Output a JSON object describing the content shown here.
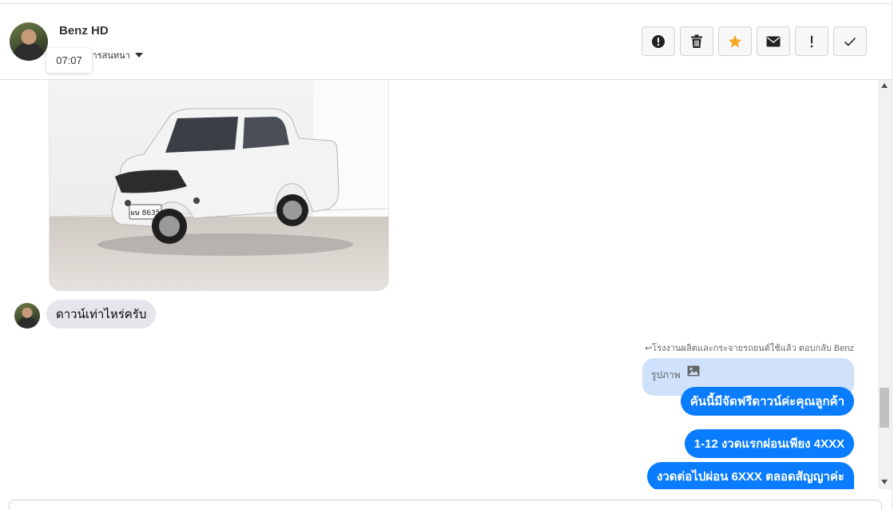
{
  "header": {
    "contact_name": "Benz HD",
    "sub_label": "ติดตามการสนทนา",
    "tooltip_time": "07:07",
    "toolbar": [
      {
        "name": "alert-circle-icon"
      },
      {
        "name": "trash-icon"
      },
      {
        "name": "star-icon",
        "color": "#f5a623"
      },
      {
        "name": "envelope-icon"
      },
      {
        "name": "exclamation-icon"
      },
      {
        "name": "check-icon"
      }
    ]
  },
  "messages": {
    "incoming_image_alt": "photo of white pickup truck, plate ผษ 8635",
    "plate_text": "ผษ 8635",
    "incoming_text": "ดาวน์เท่าไหร่ครับ",
    "reply_meta": "โรงงานผลิตและกระจายรถยนต์ใช้แล้ว ตอบกลับ Benz",
    "quoted_label": "รูปภาพ",
    "outgoing": [
      "คันนี้มีจัดฟรีดาวน์ค่ะคุณลูกค้า",
      "1-12 งวดแรกผ่อนเพียง 4XXX",
      "งวดต่อไปผ่อน 6XXX ตลอดสัญญาค่ะ"
    ]
  },
  "colors": {
    "outgoing_bubble": "#0a7cff",
    "incoming_bubble": "#e4e6eb",
    "quoted_bubble": "#cfe1fb",
    "star": "#f5a623"
  }
}
